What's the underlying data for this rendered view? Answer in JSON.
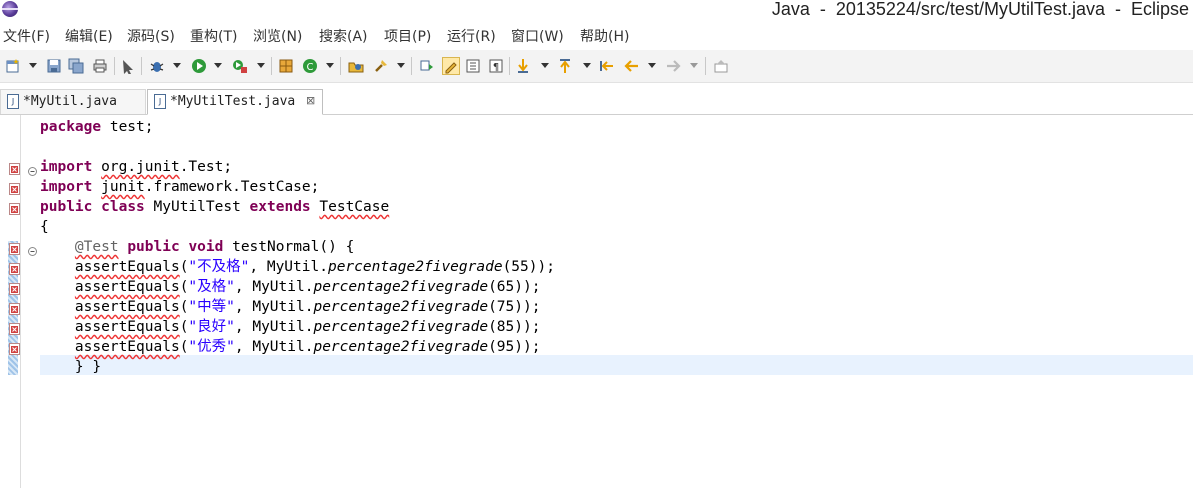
{
  "window": {
    "title": "Java  -  20135224/src/test/MyUtilTest.java  -  Eclipse"
  },
  "menu": [
    {
      "label": "文件(F)"
    },
    {
      "label": "编辑(E)"
    },
    {
      "label": "源码(S)"
    },
    {
      "label": "重构(T)"
    },
    {
      "label": "浏览(N)"
    },
    {
      "label": "搜索(A)"
    },
    {
      "label": "项目(P)"
    },
    {
      "label": "运行(R)"
    },
    {
      "label": "窗口(W)"
    },
    {
      "label": "帮助(H)"
    }
  ],
  "toolbar": {
    "icons": [
      "new-icon",
      "save-icon",
      "save-all-icon",
      "print-icon",
      "cursor-icon",
      "debug-icon",
      "run-icon",
      "external-tools-icon",
      "new-package-icon",
      "new-class-icon",
      "open-type-icon",
      "search-icon",
      "refactor-icon",
      "toggle-breakpoint-icon",
      "highlight-icon",
      "toggle-block-icon",
      "show-whitespace-icon",
      "next-annotation-icon",
      "prev-annotation-icon",
      "last-edit-icon",
      "back-icon",
      "forward-icon",
      "pin-icon"
    ],
    "colors": {
      "run": "#2e9a3a",
      "debug": "#3b6fb0",
      "error": "#d04040"
    }
  },
  "tabs": [
    {
      "label": "*MyUtil.java",
      "icon": "java-file-icon",
      "active": false
    },
    {
      "label": "*MyUtilTest.java",
      "icon": "java-file-icon",
      "active": true,
      "close": "⊠"
    }
  ],
  "editor": {
    "lines": [
      {
        "text": "package test;"
      },
      {
        "text": ""
      },
      {
        "text": "import org.junit.Test;",
        "marker": true,
        "fold": true
      },
      {
        "text": "import junit.framework.TestCase;",
        "marker": true
      },
      {
        "text": "public class MyUtilTest extends TestCase",
        "marker": true
      },
      {
        "text": "{"
      },
      {
        "text": "    @Test public void testNormal() {",
        "marker": true,
        "fold": true
      },
      {
        "text": "    assertEquals(\"不及格\", MyUtil.percentage2fivegrade(55));",
        "marker": true
      },
      {
        "text": "    assertEquals(\"及格\", MyUtil.percentage2fivegrade(65));",
        "marker": true
      },
      {
        "text": "    assertEquals(\"中等\", MyUtil.percentage2fivegrade(75));",
        "marker": true
      },
      {
        "text": "    assertEquals(\"良好\", MyUtil.percentage2fivegrade(85));",
        "marker": true
      },
      {
        "text": "    assertEquals(\"优秀\", MyUtil.percentage2fivegrade(95));",
        "marker": true
      },
      {
        "text": "    } }",
        "current": true
      }
    ],
    "tokens": {
      "l0": {
        "kw": "package",
        "rest": " test;"
      },
      "l2": {
        "kw": "import",
        "sp": " ",
        "err": "org.junit",
        "rest": ".Test;"
      },
      "l3": {
        "kw": "import",
        "sp": " ",
        "err": "junit",
        "rest": ".framework.TestCase;"
      },
      "l4": {
        "kw1": "public",
        "kw2": "class",
        "name": " MyUtilTest ",
        "kw3": "extends",
        "sp": " ",
        "err": "TestCase"
      },
      "l5": {
        "text": "{"
      },
      "l6": {
        "indent": "    ",
        "ann": "@Test",
        "kw1": "public",
        "kw2": "void",
        "rest": " testNormal() {"
      },
      "l7": {
        "call": "assertEquals",
        "open": "(",
        "str": "\"不及格\"",
        "mid": ", MyUtil.",
        "method": "percentage2fivegrade",
        "arg": "(55));"
      },
      "l8": {
        "call": "assertEquals",
        "open": "(",
        "str": "\"及格\"",
        "mid": ", MyUtil.",
        "method": "percentage2fivegrade",
        "arg": "(65));"
      },
      "l9": {
        "call": "assertEquals",
        "open": "(",
        "str": "\"中等\"",
        "mid": ", MyUtil.",
        "method": "percentage2fivegrade",
        "arg": "(75));"
      },
      "l10": {
        "call": "assertEquals",
        "open": "(",
        "str": "\"良好\"",
        "mid": ", MyUtil.",
        "method": "percentage2fivegrade",
        "arg": "(85));"
      },
      "l11": {
        "call": "assertEquals",
        "open": "(",
        "str": "\"优秀\"",
        "mid": ", MyUtil.",
        "method": "percentage2fivegrade",
        "arg": "(95));"
      },
      "l12": {
        "text": "    } }"
      }
    },
    "colors": {
      "keyword": "#7f0055",
      "string": "#2a00ff",
      "annotation": "#646464",
      "current_line": "#e8f2fe",
      "error_underline": "#e33333"
    }
  }
}
